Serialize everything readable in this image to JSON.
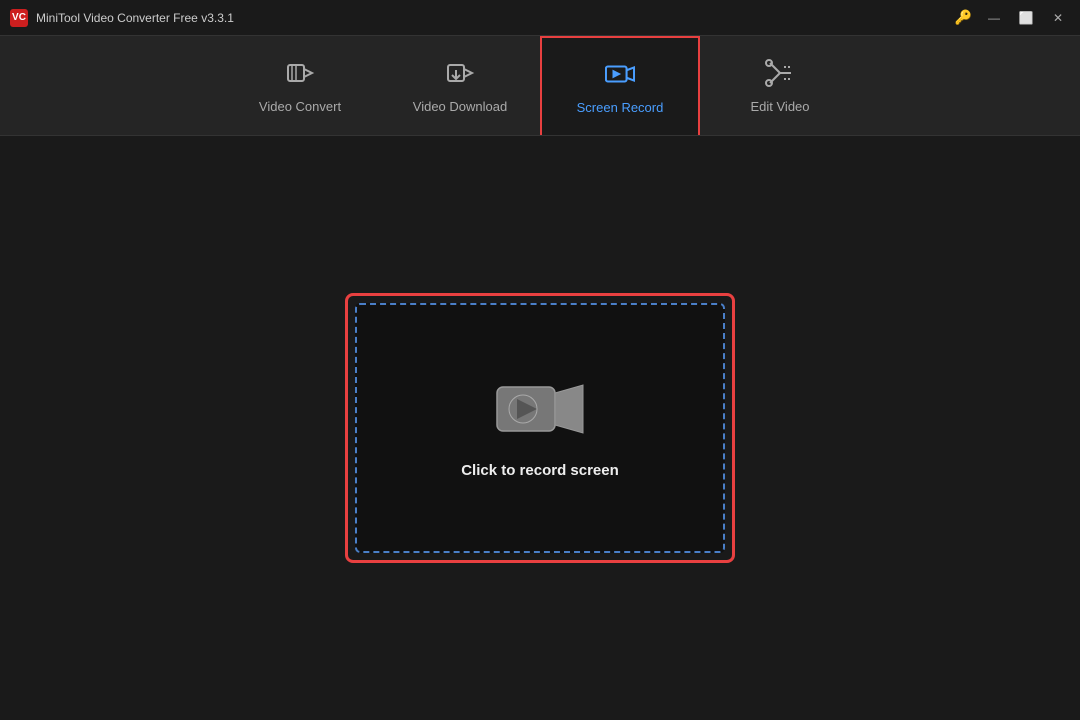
{
  "app": {
    "title": "MiniTool Video Converter Free v3.3.1",
    "logo_text": "VC"
  },
  "titlebar": {
    "key_icon": "🔑",
    "minimize_label": "—",
    "restore_label": "⬜",
    "close_label": "✕"
  },
  "nav": {
    "tabs": [
      {
        "id": "video-convert",
        "label": "Video Convert",
        "active": false
      },
      {
        "id": "video-download",
        "label": "Video Download",
        "active": false
      },
      {
        "id": "screen-record",
        "label": "Screen Record",
        "active": true
      },
      {
        "id": "edit-video",
        "label": "Edit Video",
        "active": false
      }
    ]
  },
  "record_area": {
    "click_label": "Click to record screen"
  }
}
